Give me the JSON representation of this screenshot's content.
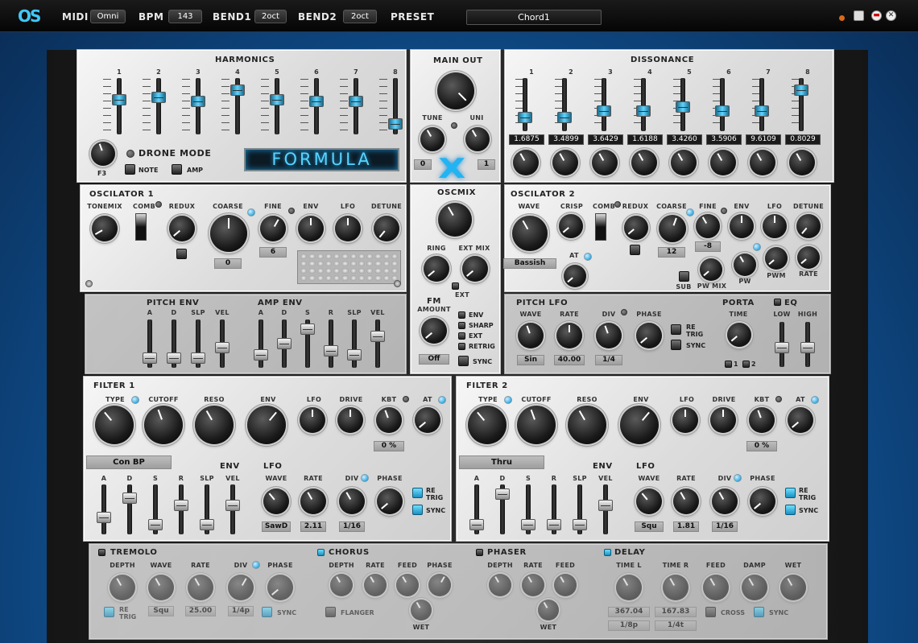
{
  "topbar": {
    "logo": "OS",
    "midi_label": "MIDI",
    "midi_value": "Omni",
    "bpm_label": "BPM",
    "bpm_value": "143",
    "bend1_label": "BEND1",
    "bend1_value": "2oct",
    "bend2_label": "BEND2",
    "bend2_value": "2oct",
    "preset_label": "PRESET",
    "preset_value": "Chord1"
  },
  "harmonics": {
    "title": "HARMONICS",
    "numbers": [
      "1",
      "2",
      "3",
      "4",
      "5",
      "6",
      "7",
      "8"
    ],
    "levels": [
      0.65,
      0.7,
      0.6,
      0.85,
      0.65,
      0.6,
      0.6,
      0.1
    ]
  },
  "drone": {
    "title": "DRONE MODE",
    "note_label": "NOTE",
    "amp_label": "AMP",
    "key_value": "F3"
  },
  "formula": "FORMULA",
  "main_out": {
    "title": "MAIN OUT",
    "tune_label": "TUNE",
    "uni_label": "UNI",
    "tune_value": "0",
    "uni_value": "1"
  },
  "dissonance": {
    "title": "DISSONANCE",
    "numbers": [
      "1",
      "2",
      "3",
      "4",
      "5",
      "6",
      "7",
      "8"
    ],
    "values": [
      "1.6875",
      "3.4899",
      "3.6429",
      "1.6188",
      "3.4260",
      "3.5906",
      "9.6109",
      "0.8029"
    ],
    "levels": [
      0.2,
      0.2,
      0.35,
      0.35,
      0.45,
      0.35,
      0.35,
      0.85
    ]
  },
  "osc1": {
    "title": "OSCILATOR 1",
    "tonemix": "TONEMIX",
    "comb": "COMB",
    "redux": "REDUX",
    "coarse": "COARSE",
    "fine": "FINE",
    "env": "ENV",
    "lfo": "LFO",
    "detune": "DETUNE",
    "coarse_value": "0",
    "fine_value": "6"
  },
  "oscmix": {
    "title": "OSCMIX",
    "ring": "RING",
    "ext_mix": "EXT MIX",
    "ext": "EXT"
  },
  "osc2": {
    "title": "OSCILATOR 2",
    "wave": "WAVE",
    "crisp": "CRISP",
    "comb": "COMB",
    "redux": "REDUX",
    "coarse": "COARSE",
    "fine": "FINE",
    "env": "ENV",
    "lfo": "LFO",
    "detune": "DETUNE",
    "wave_value": "Bassish",
    "at": "AT",
    "coarse_value": "12",
    "fine_value": "-8",
    "sub": "SUB",
    "pw_mix": "PW MIX",
    "pw": "PW",
    "pwm": "PWM",
    "rate": "RATE"
  },
  "pitch_env": {
    "title": "PITCH ENV",
    "labels": [
      "A",
      "D",
      "SLP",
      "VEL"
    ],
    "levels": [
      0.1,
      0.1,
      0.1,
      0.4
    ]
  },
  "amp_env": {
    "title": "AMP ENV",
    "labels": [
      "A",
      "D",
      "S",
      "R",
      "SLP",
      "VEL"
    ],
    "levels": [
      0.2,
      0.5,
      0.9,
      0.3,
      0.2,
      0.7
    ]
  },
  "fm": {
    "title": "FM",
    "amount": "AMOUNT",
    "value": "Off",
    "opts": [
      "ENV",
      "SHARP",
      "EXT",
      "RETRIG"
    ],
    "sync": "SYNC"
  },
  "pitch_lfo": {
    "title": "PITCH LFO",
    "wave": "WAVE",
    "rate": "RATE",
    "div": "DIV",
    "phase": "PHASE",
    "retrig": "RE TRIG",
    "sync": "SYNC",
    "wave_value": "Sin",
    "rate_value": "40.00",
    "div_value": "1/4"
  },
  "porta": {
    "title": "PORTA",
    "time": "TIME",
    "opt1": "1",
    "opt2": "2"
  },
  "eq": {
    "title": "EQ",
    "low": "LOW",
    "high": "HIGH"
  },
  "filter1": {
    "title": "FILTER 1",
    "type": "TYPE",
    "cutoff": "CUTOFF",
    "reso": "RESO",
    "env": "ENV",
    "lfo": "LFO",
    "drive": "DRIVE",
    "kbt": "KBT",
    "at": "AT",
    "kbt_value": "0 %",
    "type_value": "Con BP",
    "env_title": "ENV",
    "env_labels": [
      "A",
      "D",
      "S",
      "R",
      "SLP",
      "VEL"
    ],
    "env_levels": [
      0.3,
      0.8,
      0.1,
      0.6,
      0.1,
      0.6
    ],
    "lfo_title": "LFO",
    "wave": "WAVE",
    "rate": "RATE",
    "div": "DIV",
    "phase": "PHASE",
    "wave_value": "SawD",
    "rate_value": "2.11",
    "div_value": "1/16",
    "retrig": "RE TRIG",
    "sync": "SYNC"
  },
  "filter2": {
    "title": "FILTER 2",
    "type": "TYPE",
    "cutoff": "CUTOFF",
    "reso": "RESO",
    "env": "ENV",
    "lfo": "LFO",
    "drive": "DRIVE",
    "kbt": "KBT",
    "at": "AT",
    "kbt_value": "0 %",
    "type_value": "Thru",
    "env_title": "ENV",
    "env_labels": [
      "A",
      "D",
      "S",
      "R",
      "SLP",
      "VEL"
    ],
    "env_levels": [
      0.1,
      0.9,
      0.1,
      0.1,
      0.1,
      0.6
    ],
    "lfo_title": "LFO",
    "wave": "WAVE",
    "rate": "RATE",
    "div": "DIV",
    "phase": "PHASE",
    "wave_value": "Squ",
    "rate_value": "1.81",
    "div_value": "1/16",
    "retrig": "RE TRIG",
    "sync": "SYNC"
  },
  "tremolo": {
    "title": "TREMOLO",
    "depth": "DEPTH",
    "wave": "WAVE",
    "rate": "RATE",
    "div": "DIV",
    "phase": "PHASE",
    "wave_value": "Squ",
    "rate_value": "25.00",
    "div_value": "1/4p",
    "retrig": "RE TRIG",
    "sync": "SYNC"
  },
  "chorus": {
    "title": "CHORUS",
    "depth": "DEPTH",
    "rate": "RATE",
    "feed": "FEED",
    "phase": "PHASE",
    "flanger": "FLANGER",
    "wet": "WET"
  },
  "phaser": {
    "title": "PHASER",
    "depth": "DEPTH",
    "rate": "RATE",
    "feed": "FEED",
    "wet": "WET"
  },
  "delay": {
    "title": "DELAY",
    "time_l": "TIME L",
    "time_r": "TIME R",
    "feed": "FEED",
    "damp": "DAMP",
    "wet": "WET",
    "time_l_value": "367.04",
    "time_r_value": "167.83",
    "time_l_div": "1/8p",
    "time_r_div": "1/4t",
    "cross": "CROSS",
    "sync": "SYNC"
  }
}
